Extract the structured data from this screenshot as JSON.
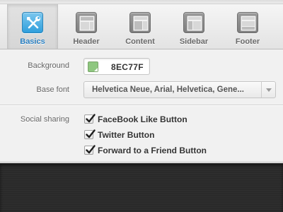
{
  "tabs": [
    {
      "id": "basics",
      "label": "Basics",
      "icon": "wrench-screwdriver-icon",
      "active": true
    },
    {
      "id": "header",
      "label": "Header",
      "icon": "layout-header-icon",
      "active": false
    },
    {
      "id": "content",
      "label": "Content",
      "icon": "layout-content-icon",
      "active": false
    },
    {
      "id": "sidebar",
      "label": "Sidebar",
      "icon": "layout-sidebar-icon",
      "active": false
    },
    {
      "id": "footer",
      "label": "Footer",
      "icon": "layout-footer-icon",
      "active": false
    }
  ],
  "form": {
    "background": {
      "label": "Background",
      "value": "8EC77F",
      "swatch_color": "#8EC77F"
    },
    "base_font": {
      "label": "Base font",
      "value": "Helvetica Neue, Arial, Helvetica, Gene..."
    },
    "social_sharing": {
      "label": "Social sharing",
      "options": [
        {
          "label": "FaceBook Like Button",
          "checked": true
        },
        {
          "label": "Twitter Button",
          "checked": true
        },
        {
          "label": "Forward to a Friend Button",
          "checked": true
        }
      ]
    }
  },
  "colors": {
    "accent": "#2A7FC0",
    "active_icon": "#3AA6E0",
    "dark_area": "#2A2A2A"
  }
}
